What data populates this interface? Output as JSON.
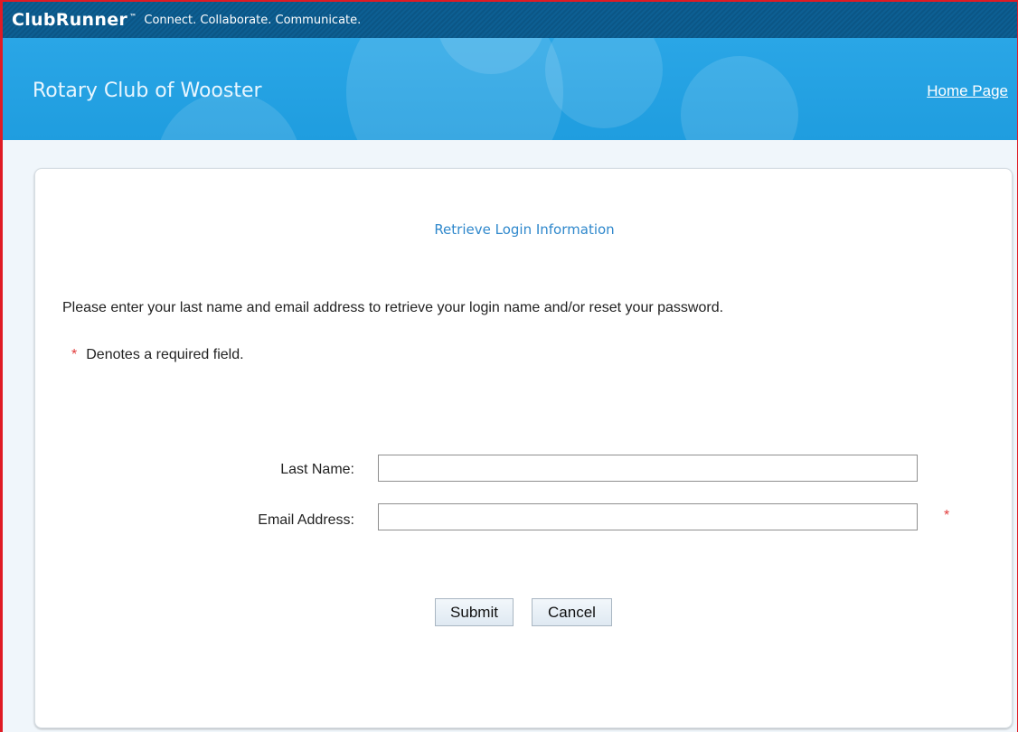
{
  "header": {
    "brand": "ClubRunner",
    "trademark": "™",
    "tagline": "Connect. Collaborate. Communicate."
  },
  "banner": {
    "club_name": "Rotary Club of Wooster",
    "home_link": "Home Page"
  },
  "form": {
    "title": "Retrieve Login Information",
    "intro": "Please enter your last name and email address to retrieve your login name and/or reset your password.",
    "required_star": "*",
    "required_note": "Denotes a required field.",
    "fields": [
      {
        "label": "Last Name:",
        "value": "",
        "required": false
      },
      {
        "label": "Email Address:",
        "value": "",
        "required": true
      }
    ],
    "buttons": {
      "submit": "Submit",
      "cancel": "Cancel"
    }
  },
  "colors": {
    "topbar": "#0d5f93",
    "banner": "#1f9ddf",
    "title": "#2f88cc",
    "required": "#e23b3b",
    "frame_border": "#e01b24"
  }
}
